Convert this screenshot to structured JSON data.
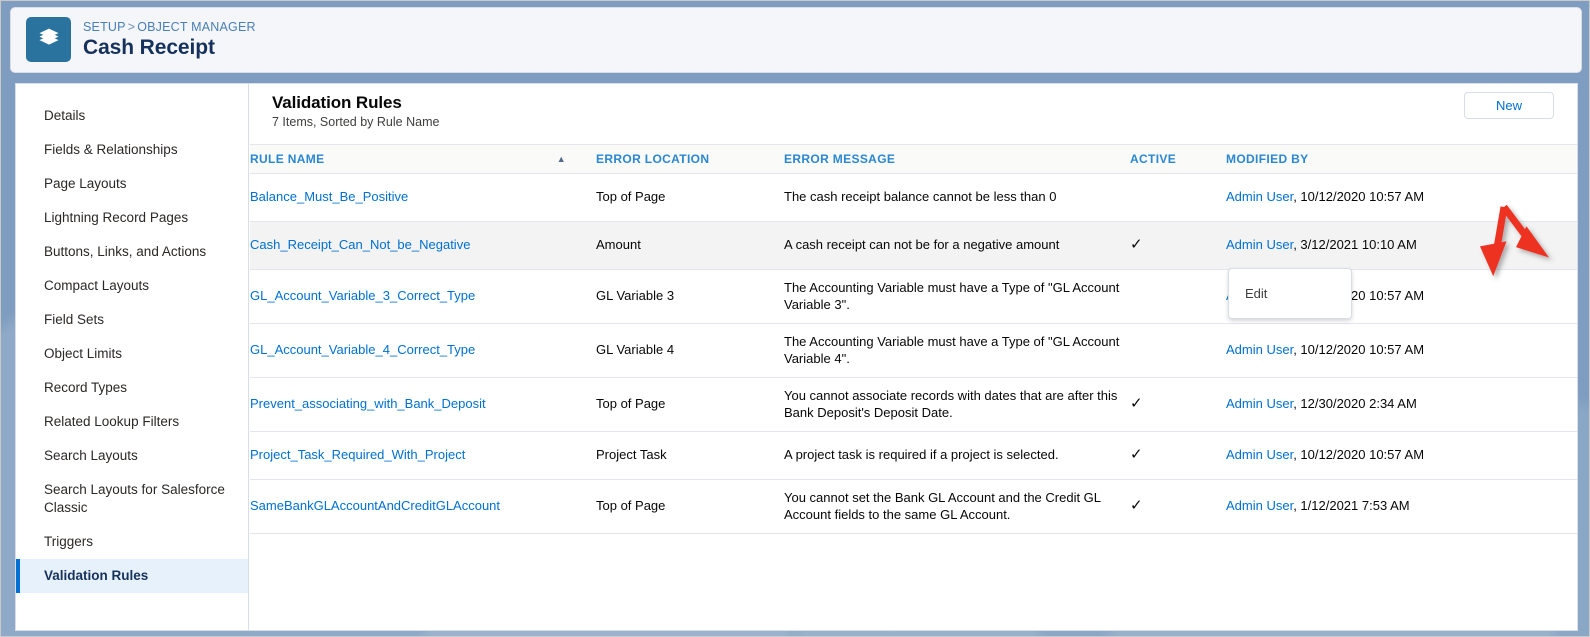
{
  "header": {
    "logo_icon": "layers-stack-icon",
    "breadcrumb": {
      "setup": "SETUP",
      "separator": ">",
      "object_manager": "OBJECT MANAGER"
    },
    "title": "Cash Receipt"
  },
  "sidebar": {
    "items": [
      {
        "label": "Details",
        "active": false
      },
      {
        "label": "Fields & Relationships",
        "active": false
      },
      {
        "label": "Page Layouts",
        "active": false
      },
      {
        "label": "Lightning Record Pages",
        "active": false
      },
      {
        "label": "Buttons, Links, and Actions",
        "active": false
      },
      {
        "label": "Compact Layouts",
        "active": false
      },
      {
        "label": "Field Sets",
        "active": false
      },
      {
        "label": "Object Limits",
        "active": false
      },
      {
        "label": "Record Types",
        "active": false
      },
      {
        "label": "Related Lookup Filters",
        "active": false
      },
      {
        "label": "Search Layouts",
        "active": false
      },
      {
        "label": "Search Layouts for Salesforce Classic",
        "active": false
      },
      {
        "label": "Triggers",
        "active": false
      },
      {
        "label": "Validation Rules",
        "active": true
      }
    ]
  },
  "main": {
    "list_title": "Validation Rules",
    "list_subtitle": "7 Items, Sorted by Rule Name",
    "new_button": "New",
    "sort_caret": "▲",
    "columns": {
      "rule_name": "RULE NAME",
      "error_location": "ERROR LOCATION",
      "error_message": "ERROR MESSAGE",
      "active": "ACTIVE",
      "modified_by": "MODIFIED BY"
    },
    "check_glyph": "✓",
    "rows": [
      {
        "rule_name": "Balance_Must_Be_Positive",
        "error_location": "Top of Page",
        "error_message": "The cash receipt balance cannot be less than 0",
        "active": false,
        "modified_by_user": "Admin User",
        "modified_by_date": ", 10/12/2020 10:57 AM"
      },
      {
        "rule_name": "Cash_Receipt_Can_Not_be_Negative",
        "error_location": "Amount",
        "error_message": "A cash receipt can not be for a negative amount",
        "active": true,
        "modified_by_user": "Admin User",
        "modified_by_date": ", 3/12/2021 10:10 AM"
      },
      {
        "rule_name": "GL_Account_Variable_3_Correct_Type",
        "error_location": "GL Variable 3",
        "error_message": "The Accounting Variable must have a Type of \"GL Account Variable 3\".",
        "active": false,
        "modified_by_user": "Admin User",
        "modified_by_date": ", 10/12/2020 10:57 AM"
      },
      {
        "rule_name": "GL_Account_Variable_4_Correct_Type",
        "error_location": "GL Variable 4",
        "error_message": "The Accounting Variable must have a Type of \"GL Account Variable 4\".",
        "active": false,
        "modified_by_user": "Admin User",
        "modified_by_date": ", 10/12/2020 10:57 AM"
      },
      {
        "rule_name": "Prevent_associating_with_Bank_Deposit",
        "error_location": "Top of Page",
        "error_message": "You cannot associate records with dates that are after this Bank Deposit's Deposit Date.",
        "active": true,
        "modified_by_user": "Admin User",
        "modified_by_date": ", 12/30/2020 2:34 AM"
      },
      {
        "rule_name": "Project_Task_Required_With_Project",
        "error_location": "Project Task",
        "error_message": "A project task is required if a project is selected.",
        "active": true,
        "modified_by_user": "Admin User",
        "modified_by_date": ", 10/12/2020 10:57 AM"
      },
      {
        "rule_name": "SameBankGLAccountAndCreditGLAccount",
        "error_location": "Top of Page",
        "error_message": "You cannot set the Bank GL Account and the Credit GL Account fields to the same GL Account.",
        "active": true,
        "modified_by_user": "Admin User",
        "modified_by_date": ", 1/12/2021 7:53 AM"
      }
    ]
  },
  "dropdown": {
    "items": [
      {
        "label": "Edit"
      }
    ]
  },
  "annotation": {
    "color": "#ee3124",
    "shape": "double-arrow"
  },
  "colors": {
    "link": "#0070d2",
    "header_link": "#2a87d0",
    "brand": "#2a739e",
    "active_nav_bg": "#e7f1fb",
    "active_nav_bar": "#0070d2",
    "row_hover": "#f3f3f3",
    "page_bg": "#7e9dc0"
  }
}
